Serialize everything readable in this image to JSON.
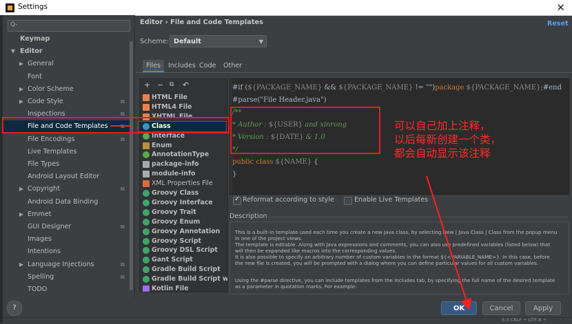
{
  "window": {
    "title": "Settings",
    "close_glyph": "✕"
  },
  "search": {
    "placeholder": "Q-"
  },
  "tree": [
    {
      "label": "Keymap",
      "bold": true,
      "indent": 0,
      "arrow": ""
    },
    {
      "label": "Editor",
      "bold": true,
      "indent": 0,
      "arrow": "▼"
    },
    {
      "label": "General",
      "indent": 1,
      "arrow": "▶"
    },
    {
      "label": "Font",
      "indent": 1,
      "arrow": ""
    },
    {
      "label": "Color Scheme",
      "indent": 1,
      "arrow": "▶"
    },
    {
      "label": "Code Style",
      "indent": 1,
      "arrow": "▶",
      "gear": true
    },
    {
      "label": "Inspections",
      "indent": 1,
      "arrow": "",
      "gear": true
    },
    {
      "label": "File and Code Templates",
      "indent": 1,
      "arrow": "",
      "gear": true,
      "selected": true
    },
    {
      "label": "File Encodings",
      "indent": 1,
      "arrow": "",
      "gear": true
    },
    {
      "label": "Live Templates",
      "indent": 1,
      "arrow": ""
    },
    {
      "label": "File Types",
      "indent": 1,
      "arrow": ""
    },
    {
      "label": "Android Layout Editor",
      "indent": 1,
      "arrow": ""
    },
    {
      "label": "Copyright",
      "indent": 1,
      "arrow": "▶",
      "gear": true
    },
    {
      "label": "Android Data Binding",
      "indent": 1,
      "arrow": ""
    },
    {
      "label": "Emmet",
      "indent": 1,
      "arrow": "▶"
    },
    {
      "label": "GUI Designer",
      "indent": 1,
      "arrow": "",
      "gear": true
    },
    {
      "label": "Images",
      "indent": 1,
      "arrow": ""
    },
    {
      "label": "Intentions",
      "indent": 1,
      "arrow": ""
    },
    {
      "label": "Language Injections",
      "indent": 1,
      "arrow": "▶",
      "gear": true
    },
    {
      "label": "Spelling",
      "indent": 1,
      "arrow": "",
      "gear": true
    },
    {
      "label": "TODO",
      "indent": 1,
      "arrow": ""
    }
  ],
  "header": {
    "breadcrumb": "Editor  ›  File and Code Templates",
    "reset_label": "Reset",
    "scheme_label": "Scheme:",
    "scheme_value": "Default"
  },
  "tabs": [
    "Files",
    "Includes",
    "Code",
    "Other"
  ],
  "list_toolbar": [
    "+",
    "−",
    "⧉",
    "↶"
  ],
  "templates": [
    {
      "label": "HTML File",
      "icon": "html-file-icon",
      "color": "#e8824a",
      "bold": true
    },
    {
      "label": "HTML4 File",
      "icon": "html-file-icon",
      "color": "#e8824a",
      "bold": true
    },
    {
      "label": "XHTML File",
      "icon": "html-file-icon",
      "color": "#e8824a",
      "bold": true
    },
    {
      "label": "Class",
      "icon": "class-icon",
      "color": "#3d8fd6",
      "bold": true,
      "selected": true
    },
    {
      "label": "Interface",
      "icon": "interface-icon",
      "color": "#5ba84a",
      "bold": true
    },
    {
      "label": "Enum",
      "icon": "enum-icon",
      "color": "#b88f3a",
      "bold": true
    },
    {
      "label": "AnnotationType",
      "icon": "annotation-icon",
      "color": "#5ba84a",
      "bold": true
    },
    {
      "label": "package-info",
      "icon": "java-file-icon",
      "color": "#a9a9a9",
      "bold": true
    },
    {
      "label": "module-info",
      "icon": "java-file-icon",
      "color": "#a9a9a9",
      "bold": true
    },
    {
      "label": "XML Properties File",
      "icon": "xml-file-icon",
      "color": "#d96a3b",
      "bold": false
    },
    {
      "label": "Groovy Class",
      "icon": "groovy-icon",
      "color": "#3fa56b",
      "bold": true
    },
    {
      "label": "Groovy Interface",
      "icon": "groovy-icon",
      "color": "#3fa56b",
      "bold": true
    },
    {
      "label": "Groovy Trait",
      "icon": "groovy-icon",
      "color": "#3fa56b",
      "bold": true
    },
    {
      "label": "Groovy Enum",
      "icon": "groovy-icon",
      "color": "#3fa56b",
      "bold": true
    },
    {
      "label": "Groovy Annotation",
      "icon": "groovy-icon",
      "color": "#3fa56b",
      "bold": true
    },
    {
      "label": "Groovy Script",
      "icon": "groovy-icon",
      "color": "#3fa56b",
      "bold": true
    },
    {
      "label": "Groovy DSL Script",
      "icon": "groovy-icon",
      "color": "#3fa56b",
      "bold": true
    },
    {
      "label": "Gant Script",
      "icon": "groovy-icon",
      "color": "#3fa56b",
      "bold": true
    },
    {
      "label": "Gradle Build Script",
      "icon": "gradle-icon",
      "color": "#3fa56b",
      "bold": true
    },
    {
      "label": "Gradle Build Script with wrapper",
      "icon": "gradle-icon",
      "color": "#3fa56b",
      "bold": true
    },
    {
      "label": "Kotlin File",
      "icon": "kotlin-icon",
      "color": "#9d6ce8",
      "bold": true
    }
  ],
  "code": {
    "line1_parts": [
      {
        "t": "#if (",
        "c": "c-norm"
      },
      {
        "t": "${PACKAGE_NAME}",
        "c": "c-grey"
      },
      {
        "t": " && ",
        "c": "c-norm"
      },
      {
        "t": "${PACKAGE_NAME}",
        "c": "c-grey"
      },
      {
        "t": " != \"\")",
        "c": "c-norm"
      },
      {
        "t": "package ",
        "c": "c-kw"
      },
      {
        "t": "${PACKAGE_NAME}",
        "c": "c-grey"
      },
      {
        "t": ";#end",
        "c": "c-norm"
      }
    ],
    "line2_parts": [
      {
        "t": "#parse(",
        "c": "c-norm"
      },
      {
        "t": "\"File Header.java\"",
        "c": "c-norm"
      },
      {
        "t": ")",
        "c": "c-norm"
      }
    ],
    "line3": "/**",
    "line4_parts": [
      {
        "t": "* Author : ",
        "c": "c-comment"
      },
      {
        "t": "${USER}",
        "c": "c-grey"
      },
      {
        "t": " and xinrong",
        "c": "c-comment"
      }
    ],
    "line5_parts": [
      {
        "t": "* Version : ",
        "c": "c-comment"
      },
      {
        "t": "${DATE}",
        "c": "c-grey"
      },
      {
        "t": " & 1.0",
        "c": "c-comment"
      }
    ],
    "line6": "*/",
    "line7_parts": [
      {
        "t": "public class ",
        "c": "c-kw"
      },
      {
        "t": "${NAME}",
        "c": "c-grey"
      },
      {
        "t": " {",
        "c": "c-norm"
      }
    ],
    "line8": "}"
  },
  "options": {
    "reformat_label": "Reformat according to style",
    "reformat_checked": true,
    "live_label": "Enable Live Templates",
    "live_checked": false
  },
  "description": {
    "header": "Description",
    "paragraphs": [
      "This is a built-in template used each time you create a new Java class, by selecting New | Java Class | Class from the popup menu in one of the project views.",
      "The template is editable. Along with Java expressions and comments, you can also use predefined variables (listed below) that will then be expanded like macros into the corresponding values.",
      "It is also possible to specify an arbitrary number of custom variables in the format ${<VARIABLE_NAME>}. In this case, before the new file is created, you will be prompted with a dialog where you can define particular values for all custom variables.",
      "Using the #parse directive, you can include templates from the Includes tab, by specifying the full name of the desired template as a parameter in quotation marks. For example:"
    ]
  },
  "buttons": {
    "help": "?",
    "ok": "OK",
    "cancel": "Cancel",
    "apply": "Apply"
  },
  "statusbar": {
    "text": "6:3   CRLF ÷   UTF-8 ÷"
  },
  "annotation": {
    "lines": [
      "可以自己加上注释，",
      "以后每新创建一个类，",
      "都会自动显示该注释"
    ],
    "color": "#ff2a2a"
  }
}
